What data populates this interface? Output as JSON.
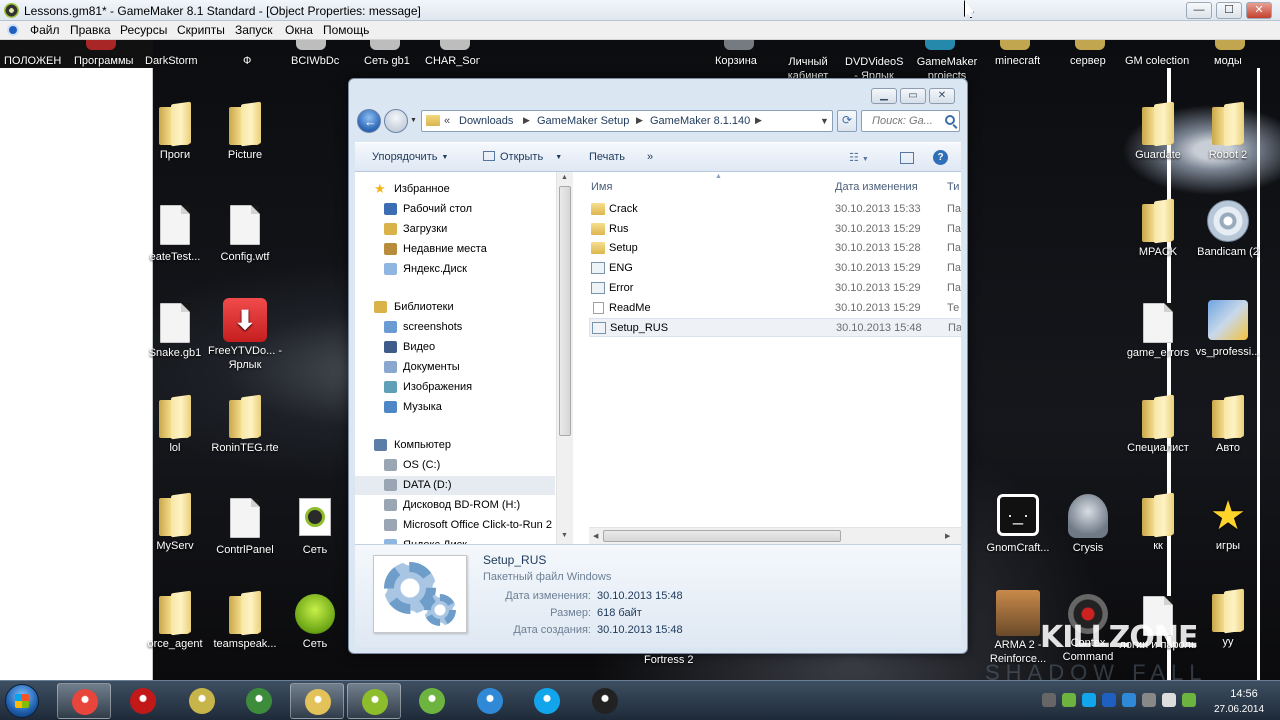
{
  "gm_window": {
    "title": "Lessons.gm81* - GameMaker 8.1 Standard - [Object Properties: message]",
    "menu": [
      "Файл",
      "Правка",
      "Ресурсы",
      "Скрипты",
      "Запуск",
      "Окна",
      "Помощь"
    ],
    "controls": {
      "minimize": "—",
      "maximize": "☐",
      "close": "✕"
    }
  },
  "desktop": {
    "top_labels": [
      "ПОЛОЖЕН",
      "Программы",
      "DarkStorm",
      "Ф",
      "BCIWbDc",
      "Сеть gb1",
      "CHAR_Son",
      "Корзина",
      "Личный кабинет",
      "DVDVideoS - Ярлык",
      "GameMaker projects",
      "minecraft",
      "сервер",
      "GM colection",
      "моды"
    ],
    "left_icons": [
      {
        "label": "Проги",
        "kind": "folder"
      },
      {
        "label": "Picture",
        "kind": "folder"
      },
      {
        "label": "eateTest...",
        "kind": "file"
      },
      {
        "label": "Config.wtf",
        "kind": "file"
      },
      {
        "label": "Snake.gb1",
        "kind": "file"
      },
      {
        "label": "FreeYTVDo... - Ярлык",
        "kind": "app"
      },
      {
        "label": "lol",
        "kind": "folder"
      },
      {
        "label": "RoninTEG.rte",
        "kind": "folder"
      },
      {
        "label": "MyServ",
        "kind": "folder"
      },
      {
        "label": "ContrlPanel",
        "kind": "file"
      },
      {
        "label": "Сеть",
        "kind": "gm"
      },
      {
        "label": "orce_agent",
        "kind": "folder"
      },
      {
        "label": "teamspeak...",
        "kind": "folder"
      },
      {
        "label": "Сеть",
        "kind": "green"
      }
    ],
    "right_icons": [
      {
        "label": "Guardate",
        "kind": "folder"
      },
      {
        "label": "Robot 2",
        "kind": "folder"
      },
      {
        "label": "MPACK",
        "kind": "folder"
      },
      {
        "label": "Bandicam (2",
        "kind": "disc"
      },
      {
        "label": "game_errors",
        "kind": "file"
      },
      {
        "label": "vs_professi...",
        "kind": "app"
      },
      {
        "label": "Специалист",
        "kind": "folder"
      },
      {
        "label": "Авто",
        "kind": "folder"
      },
      {
        "label": "GnomCraft...",
        "kind": "app"
      },
      {
        "label": "Crysis",
        "kind": "app"
      },
      {
        "label": "кк",
        "kind": "folder"
      },
      {
        "label": "игры",
        "kind": "star"
      },
      {
        "label": "ARMA 2 - Reinforce...",
        "kind": "app"
      },
      {
        "label": "Contex Command",
        "kind": "app"
      },
      {
        "label": "логин и пароль",
        "kind": "file"
      },
      {
        "label": "уу",
        "kind": "folder"
      }
    ],
    "under_window_label": "Fortress 2",
    "watermark": "KILLZONE",
    "watermark2": "SHADOW FALL"
  },
  "explorer": {
    "breadcrumb": [
      "«",
      "Downloads",
      "GameMaker Setup",
      "GameMaker 8.1.140"
    ],
    "search_placeholder": "Поиск: Ga...",
    "toolbar": {
      "organize": "Упорядочить",
      "open": "Открыть",
      "print": "Печать",
      "more": "»"
    },
    "nav": [
      {
        "label": "Избранное",
        "group": true,
        "color": "#f2b517"
      },
      {
        "label": "Рабочий стол",
        "color": "#3c6db3"
      },
      {
        "label": "Загрузки",
        "color": "#d9b24a"
      },
      {
        "label": "Недавние места",
        "color": "#b88c3a"
      },
      {
        "label": "Яндекс.Диск",
        "color": "#8fb6e0"
      },
      {
        "label": "Библиотеки",
        "group": true,
        "color": "#d9b24a"
      },
      {
        "label": "screenshots",
        "color": "#6a9bd3"
      },
      {
        "label": "Видео",
        "color": "#3e5c8a"
      },
      {
        "label": "Документы",
        "color": "#8aa8cf"
      },
      {
        "label": "Изображения",
        "color": "#5f9fb8"
      },
      {
        "label": "Музыка",
        "color": "#4f86c6"
      },
      {
        "label": "Компьютер",
        "group": true,
        "color": "#5b7ea8"
      },
      {
        "label": "OS (C:)",
        "color": "#9aa6b3"
      },
      {
        "label": "DATA (D:)",
        "color": "#9aa6b3",
        "selected": true
      },
      {
        "label": "Дисковод BD-ROM (H:)",
        "color": "#9aa6b3"
      },
      {
        "label": "Microsoft Office Click-to-Run 2",
        "color": "#9aa6b3"
      },
      {
        "label": "Яндекс.Диск",
        "color": "#8fb6e0"
      }
    ],
    "columns": {
      "name": "Имя",
      "date": "Дата изменения",
      "type": "Ти"
    },
    "files": [
      {
        "name": "Crack",
        "date": "30.10.2013 15:33",
        "type": "Па",
        "icon": "folder"
      },
      {
        "name": "Rus",
        "date": "30.10.2013 15:29",
        "type": "Па",
        "icon": "folder"
      },
      {
        "name": "Setup",
        "date": "30.10.2013 15:28",
        "type": "Па",
        "icon": "folder"
      },
      {
        "name": "ENG",
        "date": "30.10.2013 15:29",
        "type": "Па",
        "icon": "cfg"
      },
      {
        "name": "Error",
        "date": "30.10.2013 15:29",
        "type": "Па",
        "icon": "cfg"
      },
      {
        "name": "ReadMe",
        "date": "30.10.2013 15:29",
        "type": "Те",
        "icon": "txt"
      },
      {
        "name": "Setup_RUS",
        "date": "30.10.2013 15:48",
        "type": "Па",
        "icon": "cfg",
        "selected": true
      }
    ],
    "details": {
      "name": "Setup_RUS",
      "type": "Пакетный файл Windows",
      "modified_label": "Дата изменения:",
      "modified": "30.10.2013 15:48",
      "size_label": "Размер:",
      "size": "618 байт",
      "created_label": "Дата создания:",
      "created": "30.10.2013 15:48"
    }
  },
  "taskbar": {
    "apps": [
      {
        "name": "chrome",
        "color": "#e8453c",
        "active": true
      },
      {
        "name": "record",
        "color": "#c21818"
      },
      {
        "name": "game",
        "color": "#c8b54a"
      },
      {
        "name": "monitor",
        "color": "#3c8c3c"
      },
      {
        "name": "explorer",
        "color": "#e3c25a",
        "active": true
      },
      {
        "name": "gamemaker",
        "color": "#8dbd2a",
        "active": true
      },
      {
        "name": "utorrent",
        "color": "#6cb33f"
      },
      {
        "name": "app",
        "color": "#2f89d6"
      },
      {
        "name": "skype",
        "color": "#12a5ec"
      },
      {
        "name": "obs",
        "color": "#222"
      }
    ],
    "time": "14:56",
    "date": "27.06.2014"
  }
}
